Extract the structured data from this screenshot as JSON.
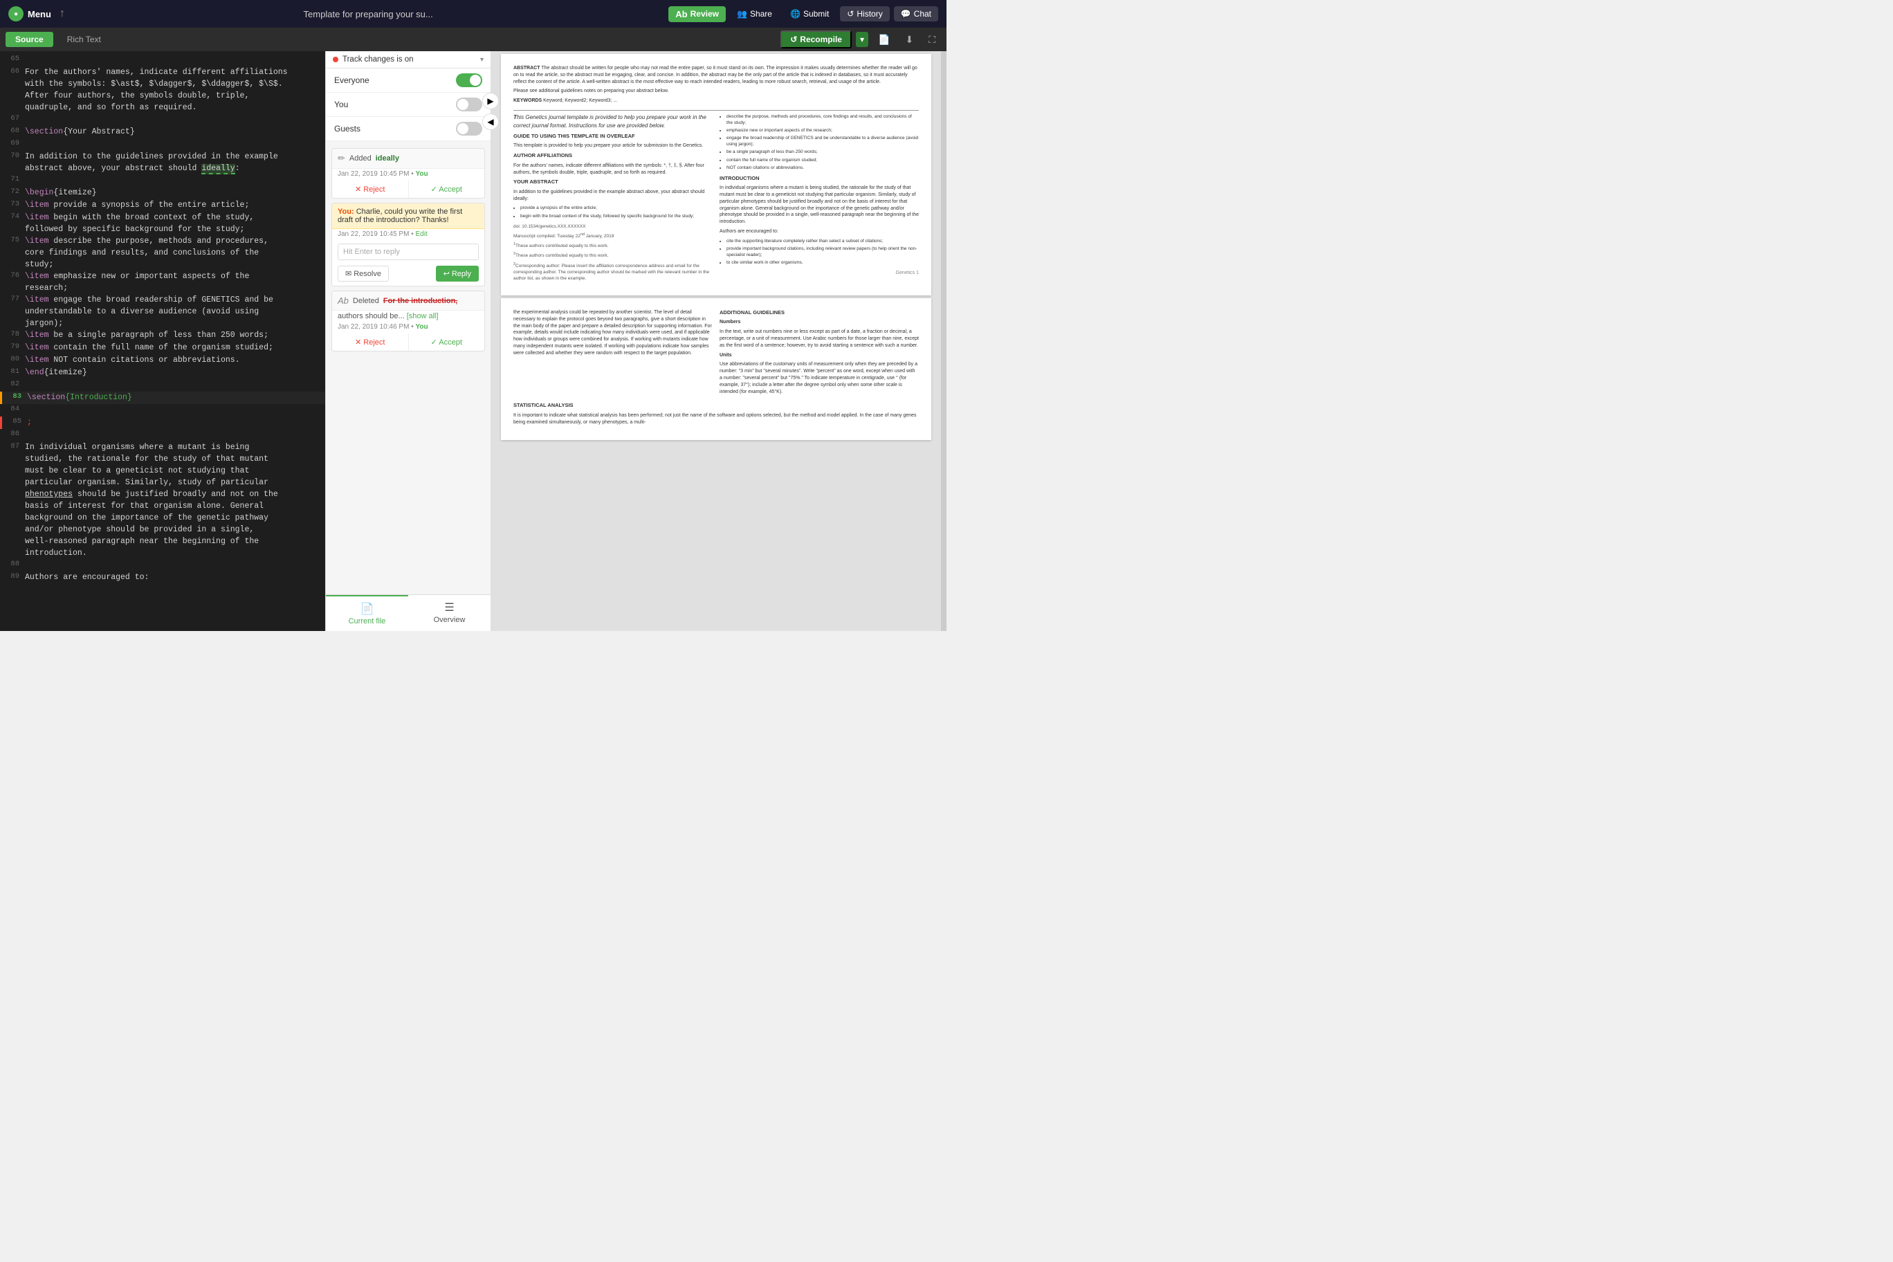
{
  "topbar": {
    "logo_label": "Menu",
    "title": "Template for preparing your su...",
    "review_label": "Review",
    "share_label": "Share",
    "submit_label": "Submit",
    "history_label": "History",
    "chat_label": "Chat"
  },
  "secondarybar": {
    "source_label": "Source",
    "richtext_label": "Rich Text",
    "recompile_label": "Recompile",
    "expand_icon": "⛶"
  },
  "review_panel": {
    "header_icon": "💬",
    "track_changes_label": "Track changes is on",
    "toggles": [
      {
        "label": "Everyone",
        "state": "on"
      },
      {
        "label": "You",
        "state": "off"
      },
      {
        "label": "Guests",
        "state": "off"
      }
    ],
    "change1": {
      "action": "Added",
      "text": "ideally",
      "date": "Jan 22, 2019 10:45 PM",
      "user": "You",
      "reject_label": "✕ Reject",
      "accept_label": "✓ Accept"
    },
    "comment1": {
      "user": "You:",
      "text": "Charlie, could you write the first draft of the introduction? Thanks!",
      "date": "Jan 22, 2019 10:45 PM",
      "edit_label": "Edit",
      "reply_placeholder": "Hit Enter to reply",
      "resolve_label": "Resolve",
      "reply_label": "↩ Reply"
    },
    "change2": {
      "action": "Deleted",
      "text": "For the introduction, authors should be...",
      "show_all": "[show all]",
      "date": "Jan 22, 2019 10:46 PM",
      "user": "You",
      "reject_label": "✕ Reject",
      "accept_label": "✓ Accept"
    },
    "bottom_tabs": [
      {
        "label": "Current file",
        "icon": "📄",
        "active": true
      },
      {
        "label": "Overview",
        "icon": "☰",
        "active": false
      }
    ]
  },
  "editor": {
    "lines": [
      {
        "num": "65",
        "content": ""
      },
      {
        "num": "66",
        "content": "For the authors' names, indicate different affiliations\nwith the symbols: $\\ast$, $\\dagger$, $\\ddagger$, $\\S$.\nAfter four authors, the symbols double, triple,\nquadruple, and so forth as required."
      },
      {
        "num": "67",
        "content": ""
      },
      {
        "num": "68",
        "content": "\\section{Your Abstract}"
      },
      {
        "num": "69",
        "content": ""
      },
      {
        "num": "70",
        "content": "In addition to the guidelines provided in the example\nabstract above, your abstract should ideally:"
      },
      {
        "num": "71",
        "content": ""
      },
      {
        "num": "72",
        "content": "\\begin{itemize}"
      },
      {
        "num": "73",
        "content": "\\item provide a synopsis of the entire article;"
      },
      {
        "num": "74",
        "content": "\\item begin with the broad context of the study,\nfollowed by specific background for the study;"
      },
      {
        "num": "75",
        "content": "\\item describe the purpose, methods and procedures,\ncore findings and results, and conclusions of the\nstudy;"
      },
      {
        "num": "76",
        "content": "\\item emphasize new or important aspects of the\nresearch;"
      },
      {
        "num": "77",
        "content": "\\item engage the broad readership of GENETICS and be\nunderstandable to a diverse audience (avoid using\njargon);"
      },
      {
        "num": "78",
        "content": "\\item be a single paragraph of less than 250 words;"
      },
      {
        "num": "79",
        "content": "\\item contain the full name of the organism studied;"
      },
      {
        "num": "80",
        "content": "\\item NOT contain citations or abbreviations."
      },
      {
        "num": "81",
        "content": "\\end{itemize}"
      },
      {
        "num": "82",
        "content": ""
      },
      {
        "num": "83",
        "content": "\\section{Introduction}"
      },
      {
        "num": "84",
        "content": ""
      },
      {
        "num": "85",
        "content": ";"
      },
      {
        "num": "86",
        "content": ""
      },
      {
        "num": "87",
        "content": "In individual organisms where a mutant is being\nstudied, the rationale for the study of that mutant\nmust be clear to a geneticist not studying that\nparticular organism. Similarly, study of particular\nphenotypes should be justified broadly and not on the\nbasis of interest for that organism alone. General\nbackground on the importance of the genetic pathway\nand/or phenotype should be provided in a single,\nwell-reasoned paragraph near the beginning of the\nintroduction."
      },
      {
        "num": "88",
        "content": ""
      },
      {
        "num": "89",
        "content": "Authors are encouraged to:"
      }
    ]
  },
  "pdf": {
    "abstract_title": "ABSTRACT",
    "abstract_text": "The abstract should be written for people who may not read the entire paper, so it must stand on its own. The impression it makes usually determines whether the reader will go on to read the article, so the abstract must be engaging, clear, and concise. In addition, the abstract may be the only part of the article that is indexed in databases, so it must accurately reflect the content of the article. A well-written abstract is the most effective way to reach intended readers, leading to more robust search, retrieval, and usage of the article.",
    "abstract_note": "Please see additional guidelines notes on preparing your abstract below.",
    "keywords_label": "KEYWORDS",
    "keywords": "Keyword; Keyword2; Keyword3; ...",
    "sections": [
      {
        "heading": "Guide to using this template in Overleaf",
        "text": "This template is provided to help you prepare your article for submission to the Genetics."
      },
      {
        "heading": "Author Affiliations",
        "text": "For the authors' names, indicate different affiliations with the symbols: *, †, ‡, §. After four authors, the symbols double, triple, quadruple, and so forth as required."
      },
      {
        "heading": "Your Abstract",
        "text": "In addition to the guidelines provided in the example abstract above, your abstract should ideally:"
      }
    ],
    "intro_heading": "Introduction",
    "intro_text": "In individual organisms where a mutant is being studied, the rationale for the study of that mutant must be clear to a geneticist not studying that particular organism. Similarly, study of particular phenotypes should be justified broadly and not on the basis of interest for that organism alone. General background on the importance of the genetic pathway and/or phenotype should be provided in a single, well-reasoned paragraph near the beginning of the introduction.",
    "authors_encouraged": "Authors are encouraged to:"
  }
}
